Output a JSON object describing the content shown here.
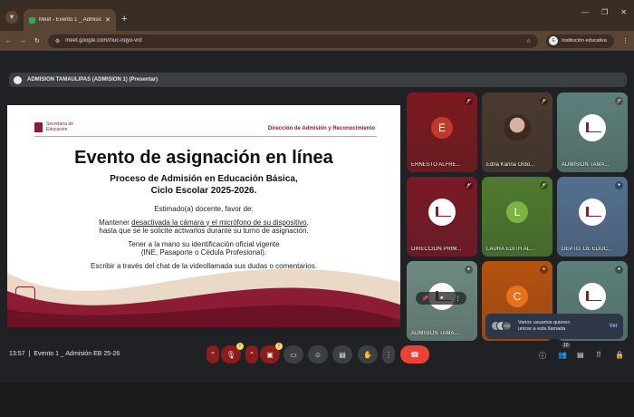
{
  "browser": {
    "tab_title": "Meet - Evento 1 _ Admisión EB",
    "tab_close": "✕",
    "new_tab": "+",
    "url": "meet.google.com/muc-nqyo-vrd",
    "profile_label": "Institución educativa",
    "profile_initial": "E"
  },
  "presenter_bar": {
    "label": "ADMISION TAMAULIPAS (ADMISION 1) (Presentar)"
  },
  "slide": {
    "logo_text": "Secretaría de Educación",
    "department": "Dirección de Admisión y Reconocimiento",
    "title": "Evento de asignación en línea",
    "subtitle_1": "Proceso de Admisión en Educación Básica,",
    "subtitle_2": "Ciclo Escolar 2025-2026.",
    "greeting": "Estimado(a) docente, favor de:",
    "line_1a": "Mantener ",
    "line_1b": "desactivada la cámara y el micrófono de su dispositivo",
    "line_1c": ",",
    "line_2": "hasta que se le solicite activarlos durante su turno de asignación.",
    "line_3": "Tener a la mano su identificación oficial vigente",
    "line_4": "(INE, Pasaporte o Cédula Profesional).",
    "line_5": "Escribir a través del chat de la videollamada sus dudas o comentarios.",
    "seal_text": "Tamaulipas"
  },
  "tiles": [
    {
      "name": "ERNESTO ALFRE...",
      "initial": "E",
      "bg": "#7b1a1f",
      "circle": "#c0392b",
      "kind": "initial"
    },
    {
      "name": "Edna Karina Ordó...",
      "initial": "",
      "bg": "#4a3a2e",
      "circle": "",
      "kind": "photo"
    },
    {
      "name": "ADMISION TAMA...",
      "initial": "",
      "bg": "#5d7f7a",
      "circle": "",
      "kind": "logo"
    },
    {
      "name": "DIRECCION PRIM...",
      "initial": "",
      "bg": "#7a1a26",
      "circle": "",
      "kind": "logo2"
    },
    {
      "name": "LAURA EDITH AL...",
      "initial": "L",
      "bg": "#4f7a2e",
      "circle": "#7cb342",
      "kind": "initial"
    },
    {
      "name": "DEPTO. DE EDUC...",
      "initial": "",
      "bg": "#54708f",
      "circle": "",
      "kind": "logo"
    },
    {
      "name": "ADMISION TAMA...",
      "initial": "",
      "bg": "#6d8a82",
      "circle": "",
      "kind": "logo"
    },
    {
      "name": "",
      "initial": "C",
      "bg": "#b5520f",
      "circle": "#e8711c",
      "kind": "initial"
    },
    {
      "name": "",
      "initial": "",
      "bg": "#5d7f7a",
      "circle": "",
      "kind": "logo"
    }
  ],
  "toast": {
    "message_1": "Varios usuarios quieren",
    "message_2": "unirse a esta llamada",
    "action": "Ver",
    "extra_count": "+20"
  },
  "meeting": {
    "time": "13:57",
    "separator": "|",
    "title": "Evento 1 _ Admisión EB 25-26",
    "participants_count": "10",
    "mic_badge": "!",
    "cam_badge": "!"
  }
}
